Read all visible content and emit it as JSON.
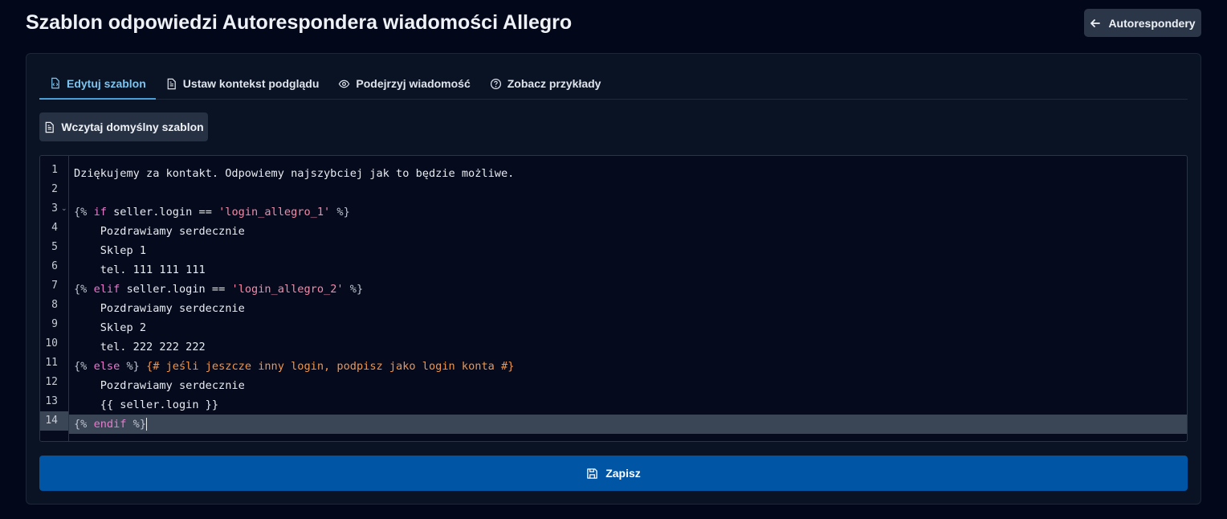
{
  "page": {
    "title": "Szablon odpowiedzi Autorespondera wiadomości Allegro",
    "back_label": "Autorespondery"
  },
  "tabs": [
    {
      "label": "Edytuj szablon",
      "icon": "code-file-icon",
      "active": true
    },
    {
      "label": "Ustaw kontekst podglądu",
      "icon": "document-icon",
      "active": false
    },
    {
      "label": "Podejrzyj wiadomość",
      "icon": "eye-icon",
      "active": false
    },
    {
      "label": "Zobacz przykłady",
      "icon": "question-circle-icon",
      "active": false
    }
  ],
  "load_default_label": "Wczytaj domyślny szablon",
  "save_label": "Zapisz",
  "editor": {
    "line_numbers": [
      "1",
      "2",
      "3",
      "4",
      "5",
      "6",
      "7",
      "8",
      "9",
      "10",
      "11",
      "12",
      "13",
      "14"
    ],
    "active_line": 14,
    "lines": [
      [
        {
          "t": "Dziękujemy za kontakt. Odpowiemy najszybciej jak to będzie możliwe.",
          "c": ""
        }
      ],
      [
        {
          "t": "",
          "c": ""
        }
      ],
      [
        {
          "t": "{%",
          "c": "brace"
        },
        {
          "t": " ",
          "c": ""
        },
        {
          "t": "if",
          "c": "kw"
        },
        {
          "t": " seller.login == ",
          "c": ""
        },
        {
          "t": "'login_allegro_1'",
          "c": "str"
        },
        {
          "t": " ",
          "c": ""
        },
        {
          "t": "%}",
          "c": "brace"
        }
      ],
      [
        {
          "t": "    Pozdrawiamy serdecznie",
          "c": ""
        }
      ],
      [
        {
          "t": "    Sklep 1",
          "c": ""
        }
      ],
      [
        {
          "t": "    tel. 111 111 111",
          "c": ""
        }
      ],
      [
        {
          "t": "{%",
          "c": "brace"
        },
        {
          "t": " ",
          "c": ""
        },
        {
          "t": "elif",
          "c": "kw"
        },
        {
          "t": " seller.login == ",
          "c": ""
        },
        {
          "t": "'login_allegro_2'",
          "c": "str"
        },
        {
          "t": " ",
          "c": ""
        },
        {
          "t": "%}",
          "c": "brace"
        }
      ],
      [
        {
          "t": "    Pozdrawiamy serdecznie",
          "c": ""
        }
      ],
      [
        {
          "t": "    Sklep 2",
          "c": ""
        }
      ],
      [
        {
          "t": "    tel. 222 222 222",
          "c": ""
        }
      ],
      [
        {
          "t": "{%",
          "c": "brace"
        },
        {
          "t": " ",
          "c": ""
        },
        {
          "t": "else",
          "c": "kw"
        },
        {
          "t": " ",
          "c": ""
        },
        {
          "t": "%}",
          "c": "brace"
        },
        {
          "t": " ",
          "c": ""
        },
        {
          "t": "{# jeśli jeszcze inny login, podpisz jako login konta #}",
          "c": "cmt"
        }
      ],
      [
        {
          "t": "    Pozdrawiamy serdecznie",
          "c": ""
        }
      ],
      [
        {
          "t": "    {{ seller.login }}",
          "c": ""
        }
      ],
      [
        {
          "t": "{%",
          "c": "brace"
        },
        {
          "t": " ",
          "c": ""
        },
        {
          "t": "endif",
          "c": "kw"
        },
        {
          "t": " ",
          "c": ""
        },
        {
          "t": "%}",
          "c": "brace"
        }
      ]
    ]
  },
  "colors": {
    "background": "#03071a",
    "accent": "#7cc3ee",
    "save_button": "#0055a4"
  }
}
